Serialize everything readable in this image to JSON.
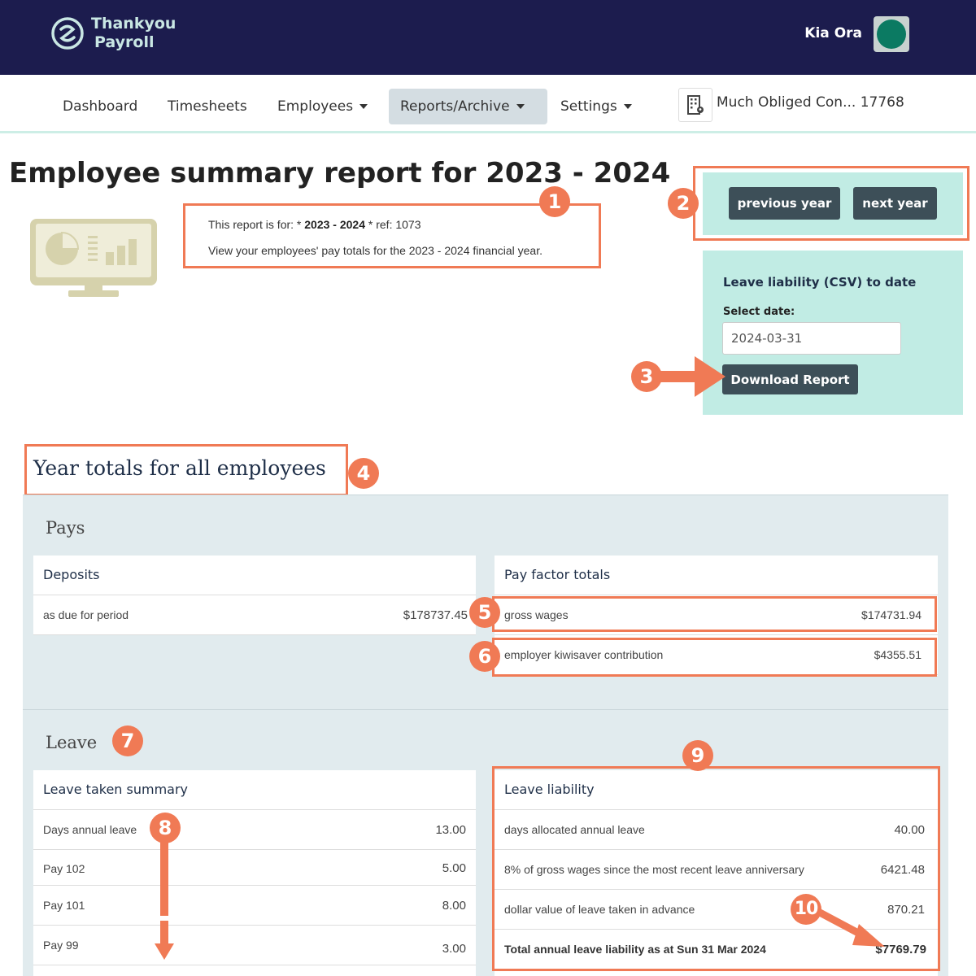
{
  "header": {
    "logo_line1": "Thankyou",
    "logo_line2": "Payroll",
    "greeting": "Kia Ora"
  },
  "nav": {
    "items": [
      {
        "label": "Dashboard",
        "dropdown": false
      },
      {
        "label": "Timesheets",
        "dropdown": false
      },
      {
        "label": "Employees",
        "dropdown": true
      },
      {
        "label": "Reports/Archive",
        "dropdown": true,
        "active": true
      },
      {
        "label": "Settings",
        "dropdown": true
      }
    ],
    "company": "Much Obliged Con... 17768"
  },
  "page": {
    "title": "Employee summary report for 2023 - 2024",
    "report_for_prefix": "This report is for: * ",
    "report_period": "2023 - 2024",
    "report_ref_prefix": " * ref: ",
    "report_ref": "1073",
    "description": "View your employees' pay totals for the 2023 - 2024 financial year."
  },
  "year_nav": {
    "previous_label": "previous year",
    "next_label": "next year"
  },
  "leave_panel": {
    "title": "Leave liability (CSV) to date",
    "select_label": "Select date:",
    "date_value": "2024-03-31",
    "download_label": "Download Report"
  },
  "year_totals": {
    "title": "Year totals for all employees",
    "pays": {
      "title": "Pays",
      "deposits": {
        "title": "Deposits",
        "rows": [
          {
            "label": "as due for period",
            "value": "$178737.45"
          }
        ]
      },
      "pay_factor": {
        "title": "Pay factor totals",
        "rows": [
          {
            "label": "gross wages",
            "value": "$174731.94"
          },
          {
            "label": "employer kiwisaver contribution",
            "value": "$4355.51"
          }
        ]
      }
    },
    "leave": {
      "title": "Leave",
      "taken": {
        "title": "Leave taken summary",
        "rows": [
          {
            "label": "Days annual leave",
            "value": "13.00"
          },
          {
            "label": "Pay 102",
            "value": "5.00"
          },
          {
            "label": "Pay 101",
            "value": "8.00"
          },
          {
            "label": "Pay 99",
            "value": "3.00"
          }
        ]
      },
      "liability": {
        "title": "Leave liability",
        "rows": [
          {
            "label": "days allocated annual leave",
            "value": "40.00"
          },
          {
            "label": "8% of gross wages since the most recent leave anniversary",
            "value": "6421.48"
          },
          {
            "label": "dollar value of leave taken in advance",
            "value": "870.21"
          }
        ],
        "total_label": "Total annual leave liability as at Sun 31 Mar 2024",
        "total_value": "$7769.79"
      }
    }
  },
  "annotations": [
    "1",
    "2",
    "3",
    "4",
    "5",
    "6",
    "7",
    "8",
    "9",
    "10"
  ],
  "colors": {
    "header_bg": "#1c1c4e",
    "panel_bg": "#c1ece4",
    "section_bg": "#e1ebee",
    "annotation": "#f07a55",
    "button_bg": "#3d4f58"
  }
}
